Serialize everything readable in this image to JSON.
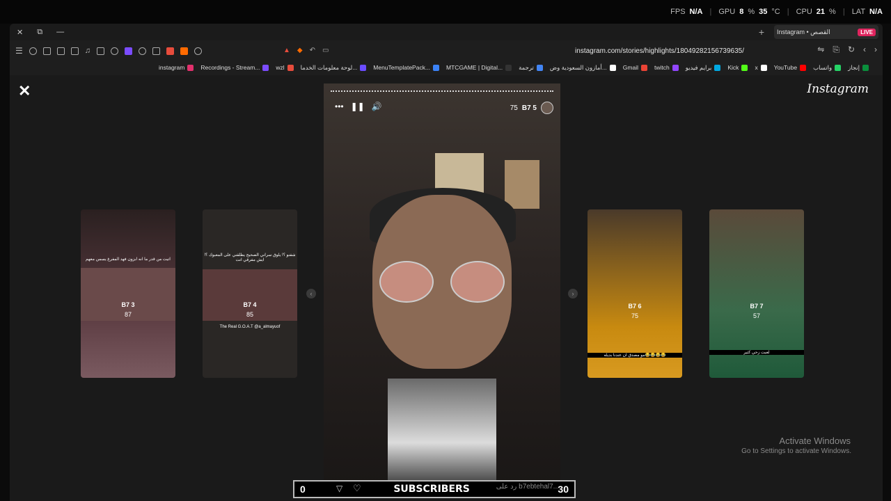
{
  "perf": {
    "fps_label": "FPS",
    "fps_value": "N/A",
    "gpu_label": "GPU",
    "gpu_value": "8",
    "gpu_unit": "%",
    "gpu_temp": "35",
    "gpu_temp_unit": "°C",
    "cpu_label": "CPU",
    "cpu_value": "21",
    "cpu_unit": "%",
    "lat_label": "LAT",
    "lat_value": "N/A"
  },
  "tab": {
    "title": "Instagram • القصص",
    "live": "LIVE"
  },
  "address": {
    "url": "instagram.com/stories/highlights/18049282156739635/"
  },
  "bookmarks": [
    {
      "label": "instagram",
      "color": "#e1306c"
    },
    {
      "label": "Recordings - Stream...",
      "color": "#7b4cff"
    },
    {
      "label": "wzl",
      "color": "#e74c3c"
    },
    {
      "label": "لوحة معلومات الخدما...",
      "color": "#6a4cff"
    },
    {
      "label": "MenuTemplatePack...",
      "color": "#3b82f6"
    },
    {
      "label": "MTCGAME | Digital...",
      "color": "#333"
    },
    {
      "label": "ترجمة",
      "color": "#4285f4"
    },
    {
      "label": "أمازون السعودية وض...",
      "color": "#fff"
    },
    {
      "label": "Gmail",
      "color": "#ea4335"
    },
    {
      "label": "twitch",
      "color": "#9146ff"
    },
    {
      "label": "برايم فيديو",
      "color": "#00a8e1"
    },
    {
      "label": "Kick",
      "color": "#53fc18"
    },
    {
      "label": "x",
      "color": "#fff"
    },
    {
      "label": "YouTube",
      "color": "#ff0000"
    },
    {
      "label": "واتساب",
      "color": "#25d366"
    },
    {
      "label": "إنجاز",
      "color": "#0a8f3c"
    }
  ],
  "story": {
    "logo": "Instagram",
    "main_name": "B7 5",
    "main_count": "75",
    "more_icon": "•••",
    "pause_icon": "❚❚",
    "sound_icon": "🔊"
  },
  "cards": [
    {
      "name": "B7 3",
      "count": "87",
      "text": "اتيت من قدر ما انه ابزون فهد المفرغ يسمن معهم"
    },
    {
      "name": "B7 4",
      "count": "85",
      "text": "شفنو ؟! يلوق سراني الصحيح يطلقني على المعبوك ؟! ايش مفرقي انت",
      "caption": "The Real G.O.A.T @a_almayuof"
    },
    {
      "name": "B7 6",
      "count": "75",
      "text": "مو مصدق ان عندنا بديله😂😂😂😂"
    },
    {
      "name": "B7 7",
      "count": "57",
      "text": "لعبت زحي كثير"
    }
  ],
  "subscribers": {
    "left": "0",
    "label": "SUBSCRIBERS",
    "right": "30",
    "reply_placeholder": "رد على b7ebtehal7..."
  },
  "watermark": {
    "title": "Activate Windows",
    "subtitle": "Go to Settings to activate Windows."
  }
}
